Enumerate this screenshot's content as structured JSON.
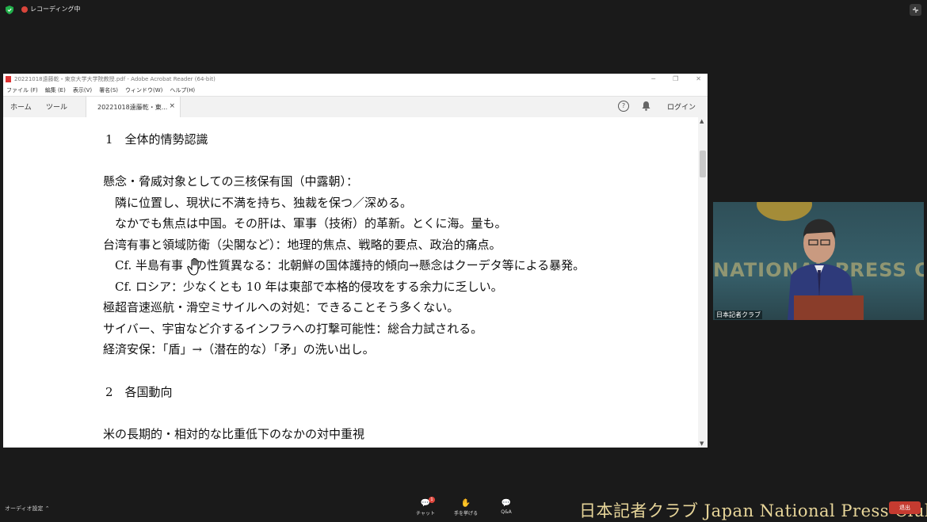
{
  "zoom_top": {
    "recording_label": "レコーディング中"
  },
  "acrobat": {
    "window_title": "20221018遠藤乾・東京大学大学院教授.pdf - Adobe Acrobat Reader (64-bit)",
    "menu": [
      "ファイル (F)",
      "編集 (E)",
      "表示(V)",
      "署名(S)",
      "ウィンドウ(W)",
      "ヘルプ(H)"
    ],
    "tabs": {
      "home": "ホーム",
      "tools": "ツール",
      "doc": "20221018遠藤乾・東...",
      "doc_close": "×"
    },
    "help": "?",
    "login": "ログイン"
  },
  "document": {
    "lines": [
      "1　全体的情勢認識",
      "懸念・脅威対象としての三核保有国（中露朝）：",
      "隣に位置し、現状に不満を持ち、独裁を保つ／深める。",
      "なかでも焦点は中国。その肝は、軍事（技術）的革新。とくに海。量も。",
      "台湾有事と領域防衛（尖閣など）：地理的焦点、戦略的要点、政治的痛点。",
      "Cf.  半島有事　の性質異なる：北朝鮮の国体護持的傾向→懸念はクーデタ等による暴発。",
      "Cf.  ロシア：少なくとも 10 年は東部で本格的侵攻をする余力に乏しい。",
      "極超音速巡航・滑空ミサイルへの対処：できることそう多くない。",
      "サイバー、宇宙など介するインフラへの打撃可能性：総合力試される。",
      "経済安保：「盾」→（潜在的な）「矛」の洗い出し。",
      "2　各国動向",
      "米の長期的・相対的な比重低下のなかの対中重視"
    ]
  },
  "video": {
    "banner_text": "NATIONAL PRESS CL",
    "label": "日本記者クラブ"
  },
  "bottom": {
    "audio_settings": "オーディオ設定",
    "chat_label": "チャット",
    "chat_badge": "1",
    "raise_hand_label": "手を挙げる",
    "qa_label": "Q&A",
    "watermark": "日本記者クラブ Japan National Press Club",
    "end_label": "退出"
  },
  "colors": {
    "recording_dot": "#d9453b",
    "end_button": "#c53b30"
  }
}
